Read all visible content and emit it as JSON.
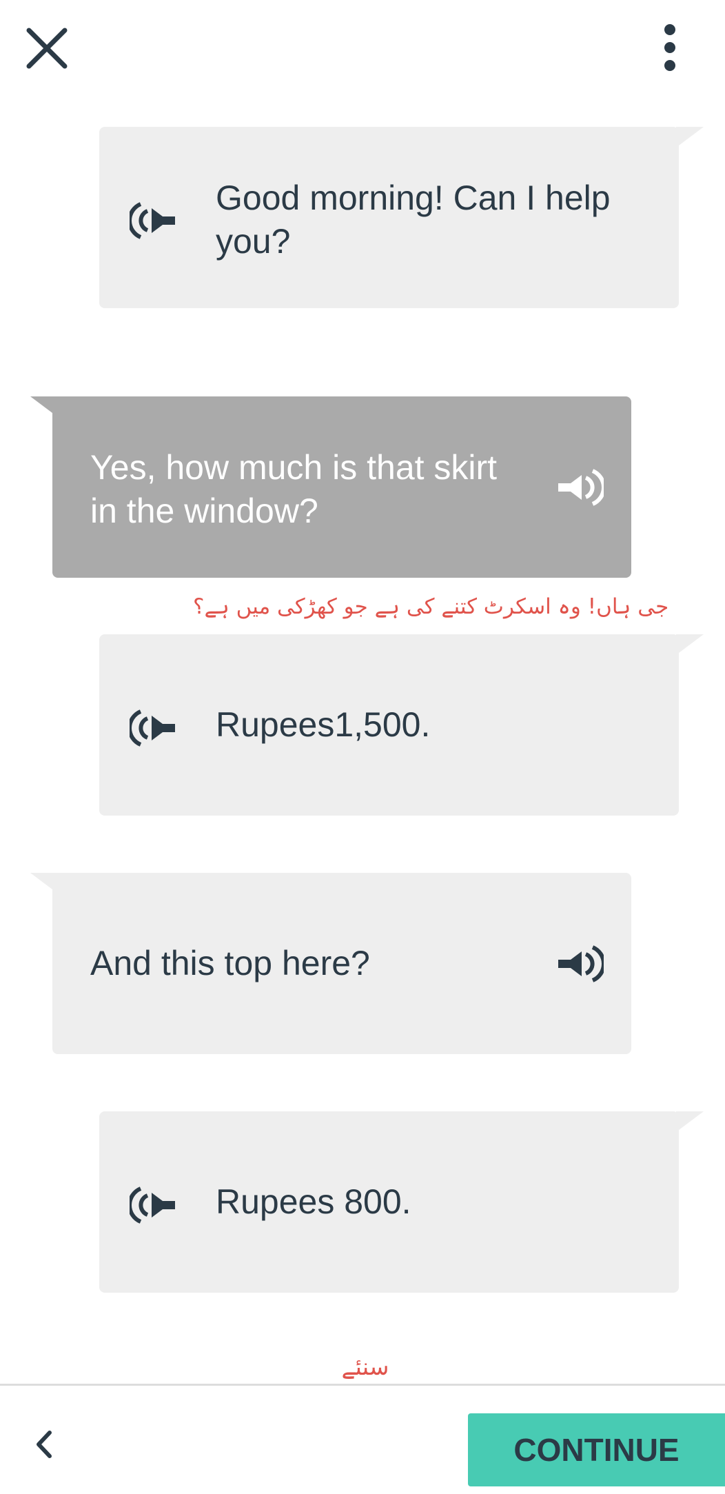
{
  "header": {
    "close_icon": "close-icon",
    "menu_icon": "more-vertical-icon"
  },
  "dialogue": [
    {
      "speaker_side": "left-speaker-right-bubble",
      "text": "Good morning! Can I help you?",
      "icon": "speaker-icon"
    },
    {
      "speaker_side": "user",
      "text": "Yes, how much is that skirt in the window?",
      "icon": "speaker-icon",
      "highlighted": true
    },
    {
      "speaker_side": "left-speaker-right-bubble",
      "text": "Rupees1,500.",
      "icon": "speaker-icon"
    },
    {
      "speaker_side": "user",
      "text": "And this top here?",
      "icon": "speaker-icon"
    },
    {
      "speaker_side": "left-speaker-right-bubble",
      "text": "Rupees 800.",
      "icon": "speaker-icon"
    }
  ],
  "translation": "جی ہاں! وہ اسکرٹ کتنے کی ہے جو کھڑکی میں ہے؟",
  "listen_label": "سنئے",
  "footer": {
    "back_icon": "chevron-left-icon",
    "continue_label": "CONTINUE"
  },
  "colors": {
    "bubble": "#eeeeee",
    "bubble_active": "#aaaaaa",
    "text": "#2b3a46",
    "accent": "#48cbb3",
    "translation": "#e0534b"
  }
}
